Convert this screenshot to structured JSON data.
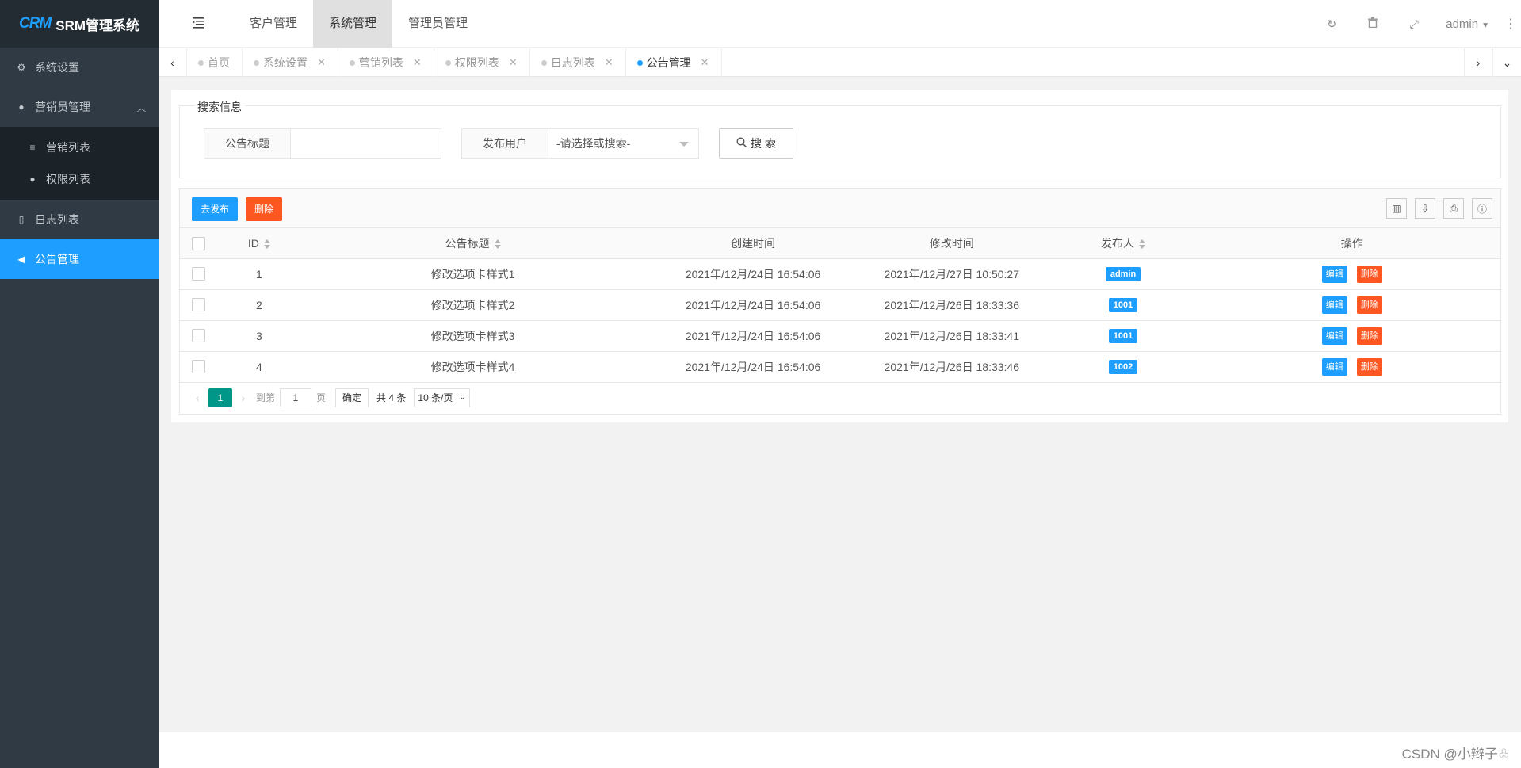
{
  "app": {
    "logo_mark": "CRM",
    "title": "SRM管理系统"
  },
  "sidebar": {
    "items": [
      {
        "label": "系统设置",
        "icon": "gears-icon"
      },
      {
        "label": "营销员管理",
        "icon": "user-icon"
      },
      {
        "label": "日志列表",
        "icon": "bookmark-icon"
      },
      {
        "label": "公告管理",
        "icon": "bullhorn-icon"
      }
    ],
    "sub_items": [
      {
        "label": "营销列表",
        "icon": "sliders-icon"
      },
      {
        "label": "权限列表",
        "icon": "user-times-icon"
      }
    ]
  },
  "header": {
    "nav": [
      "客户管理",
      "系统管理",
      "管理员管理"
    ],
    "user": "admin"
  },
  "tabs": [
    {
      "label": "首页",
      "closable": false
    },
    {
      "label": "系统设置",
      "closable": true
    },
    {
      "label": "营销列表",
      "closable": true
    },
    {
      "label": "权限列表",
      "closable": true
    },
    {
      "label": "日志列表",
      "closable": true
    },
    {
      "label": "公告管理",
      "closable": true
    }
  ],
  "search": {
    "legend": "搜索信息",
    "title_label": "公告标题",
    "title_value": "",
    "user_label": "发布用户",
    "user_placeholder": "-请选择或搜索-",
    "button": "搜 索"
  },
  "toolbar": {
    "publish": "去发布",
    "delete": "删除"
  },
  "table": {
    "columns": [
      "ID",
      "公告标题",
      "创建时间",
      "修改时间",
      "发布人",
      "操作"
    ],
    "rows": [
      {
        "id": "1",
        "title": "修改选项卡样式1",
        "created": "2021年/12月/24日 16:54:06",
        "modified": "2021年/12月/27日 10:50:27",
        "publisher": "admin"
      },
      {
        "id": "2",
        "title": "修改选项卡样式2",
        "created": "2021年/12月/24日 16:54:06",
        "modified": "2021年/12月/26日 18:33:36",
        "publisher": "1001"
      },
      {
        "id": "3",
        "title": "修改选项卡样式3",
        "created": "2021年/12月/24日 16:54:06",
        "modified": "2021年/12月/26日 18:33:41",
        "publisher": "1001"
      },
      {
        "id": "4",
        "title": "修改选项卡样式4",
        "created": "2021年/12月/24日 16:54:06",
        "modified": "2021年/12月/26日 18:33:46",
        "publisher": "1002"
      }
    ],
    "edit_label": "编辑",
    "delete_label": "删除"
  },
  "pager": {
    "current": "1",
    "goto_label": "到第",
    "page_input": "1",
    "page_suffix": "页",
    "confirm": "确定",
    "total": "共 4 条",
    "per_page": "10 条/页"
  },
  "footer": {
    "watermark": "CSDN @小辫子♧"
  },
  "colors": {
    "primary": "#1e9fff",
    "danger": "#ff5722",
    "pager_active": "#009688",
    "sidebar": "#2f3a45"
  }
}
